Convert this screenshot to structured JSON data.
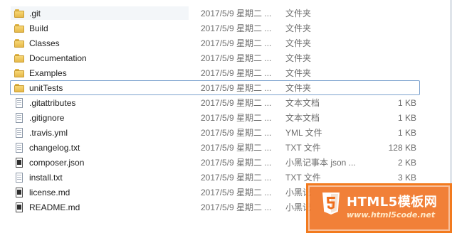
{
  "files": [
    {
      "name": ".git",
      "date": "2017/5/9 星期二 ...",
      "type": "文件夹",
      "size": "",
      "icon": "folder-icon"
    },
    {
      "name": "Build",
      "date": "2017/5/9 星期二 ...",
      "type": "文件夹",
      "size": "",
      "icon": "folder-icon"
    },
    {
      "name": "Classes",
      "date": "2017/5/9 星期二 ...",
      "type": "文件夹",
      "size": "",
      "icon": "folder-icon"
    },
    {
      "name": "Documentation",
      "date": "2017/5/9 星期二 ...",
      "type": "文件夹",
      "size": "",
      "icon": "folder-icon"
    },
    {
      "name": "Examples",
      "date": "2017/5/9 星期二 ...",
      "type": "文件夹",
      "size": "",
      "icon": "folder-icon"
    },
    {
      "name": "unitTests",
      "date": "2017/5/9 星期二 ...",
      "type": "文件夹",
      "size": "",
      "icon": "folder-icon"
    },
    {
      "name": ".gitattributes",
      "date": "2017/5/9 星期二 ...",
      "type": "文本文档",
      "size": "1 KB",
      "icon": "text-file-icon"
    },
    {
      "name": ".gitignore",
      "date": "2017/5/9 星期二 ...",
      "type": "文本文档",
      "size": "1 KB",
      "icon": "text-file-icon"
    },
    {
      "name": ".travis.yml",
      "date": "2017/5/9 星期二 ...",
      "type": "YML 文件",
      "size": "1 KB",
      "icon": "text-file-icon"
    },
    {
      "name": "changelog.txt",
      "date": "2017/5/9 星期二 ...",
      "type": "TXT 文件",
      "size": "128 KB",
      "icon": "text-file-icon"
    },
    {
      "name": "composer.json",
      "date": "2017/5/9 星期二 ...",
      "type": "小黑记事本 json ...",
      "size": "2 KB",
      "icon": "editor-doc-icon"
    },
    {
      "name": "install.txt",
      "date": "2017/5/9 星期二 ...",
      "type": "TXT 文件",
      "size": "3 KB",
      "icon": "text-file-icon"
    },
    {
      "name": "license.md",
      "date": "2017/5/9 星期二 ...",
      "type": "小黑记",
      "size": "",
      "icon": "editor-doc-icon"
    },
    {
      "name": "README.md",
      "date": "2017/5/9 星期二 ...",
      "type": "小黑记",
      "size": "",
      "icon": "editor-doc-icon"
    }
  ],
  "selected_index": 5,
  "watermark": {
    "title": "HTML5模板网",
    "url": "www.html5code.net",
    "logo": "html5-shield-icon",
    "color": "#ef6e1c"
  },
  "colors": {
    "selection_border": "#7da2ce",
    "folder": "#f7d777",
    "secondary_text": "#6d6d6d"
  }
}
